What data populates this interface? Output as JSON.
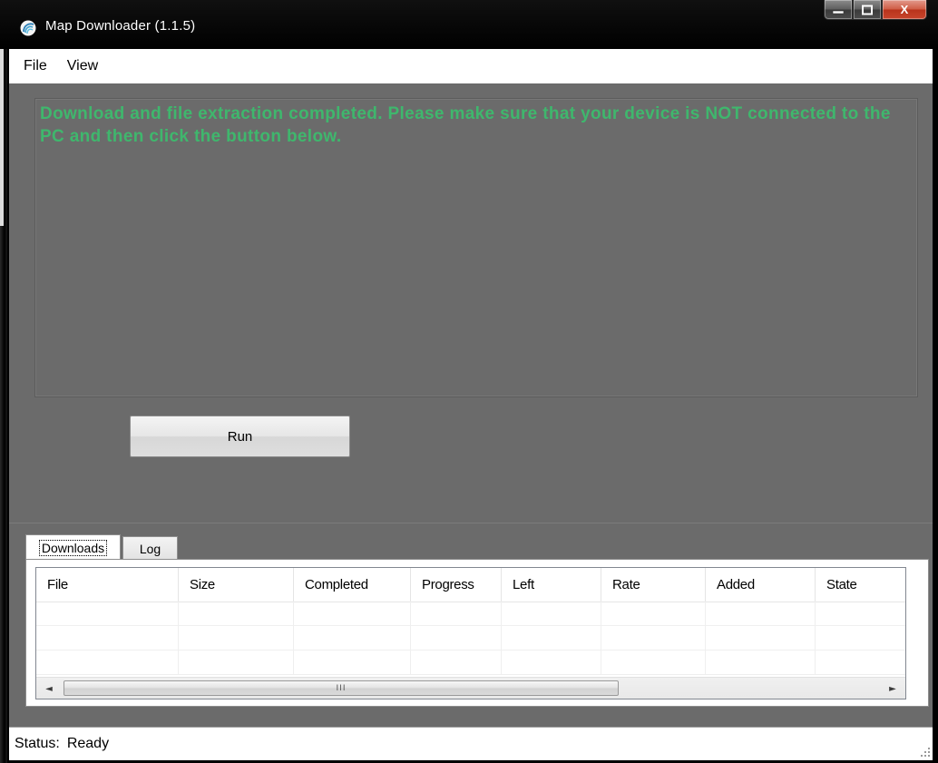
{
  "window": {
    "title": "Map Downloader (1.1.5)",
    "buttons": {
      "minimize": "—",
      "maximize": "☐",
      "close": "X"
    }
  },
  "menu": {
    "items": [
      {
        "label": "File"
      },
      {
        "label": "View"
      }
    ]
  },
  "message": {
    "text": "Download and file extraction completed. Please make sure that your device is NOT connected to the PC and then click the button below.",
    "color": "#3fb76d"
  },
  "run_button": {
    "label": "Run"
  },
  "tabs": [
    {
      "label": "Downloads",
      "active": true
    },
    {
      "label": "Log",
      "active": false
    }
  ],
  "downloads_table": {
    "columns": [
      "File",
      "Size",
      "Completed",
      "Progress",
      "Left",
      "Rate",
      "Added",
      "State"
    ],
    "rows": []
  },
  "scrollbar": {
    "thumb_grip": "III"
  },
  "status": {
    "label": "Status:",
    "value": "Ready"
  },
  "icons": {
    "app": "map-downloader-logo-icon",
    "scroll_left": "◄",
    "scroll_right": "►",
    "resize_grip": "resize-grip-icon"
  }
}
